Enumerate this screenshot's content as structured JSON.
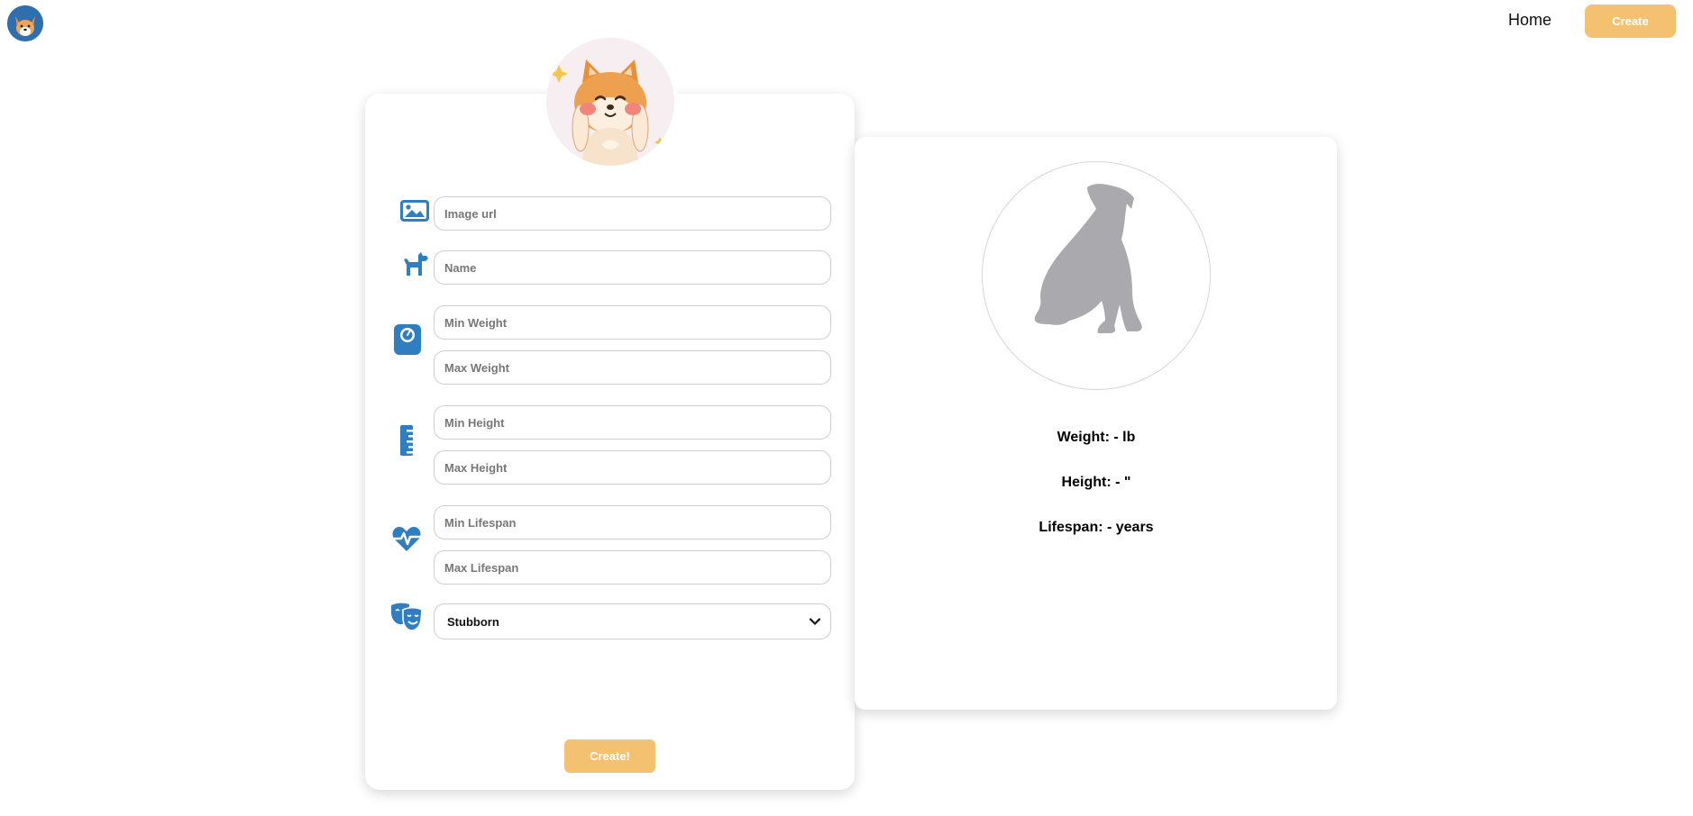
{
  "nav": {
    "home_label": "Home",
    "create_label": "Create",
    "logo_icon": "corgi-logo-icon"
  },
  "form": {
    "avatar_icon": "shiba-inu-avatar",
    "fields": {
      "image_url": {
        "placeholder": "Image url",
        "icon": "image-icon"
      },
      "name": {
        "placeholder": "Name",
        "icon": "dog-icon"
      },
      "min_weight": {
        "placeholder": "Min Weight",
        "icon": "weight-scale-icon"
      },
      "max_weight": {
        "placeholder": "Max Weight"
      },
      "min_height": {
        "placeholder": "Min Height",
        "icon": "ruler-icon"
      },
      "max_height": {
        "placeholder": "Max Height"
      },
      "min_lifespan": {
        "placeholder": "Min Lifespan",
        "icon": "heartbeat-icon"
      },
      "max_lifespan": {
        "placeholder": "Max Lifespan"
      }
    },
    "temperament": {
      "selected": "Stubborn",
      "icon": "theater-masks-icon"
    },
    "submit_label": "Create!"
  },
  "preview": {
    "image_icon": "dog-silhouette",
    "weight": "Weight: - lb",
    "height": "Height: - \"",
    "lifespan": "Lifespan: - years"
  },
  "colors": {
    "accent": "#f3c170",
    "icon_blue": "#2f7ec2",
    "silhouette": "#a9a9ae"
  }
}
